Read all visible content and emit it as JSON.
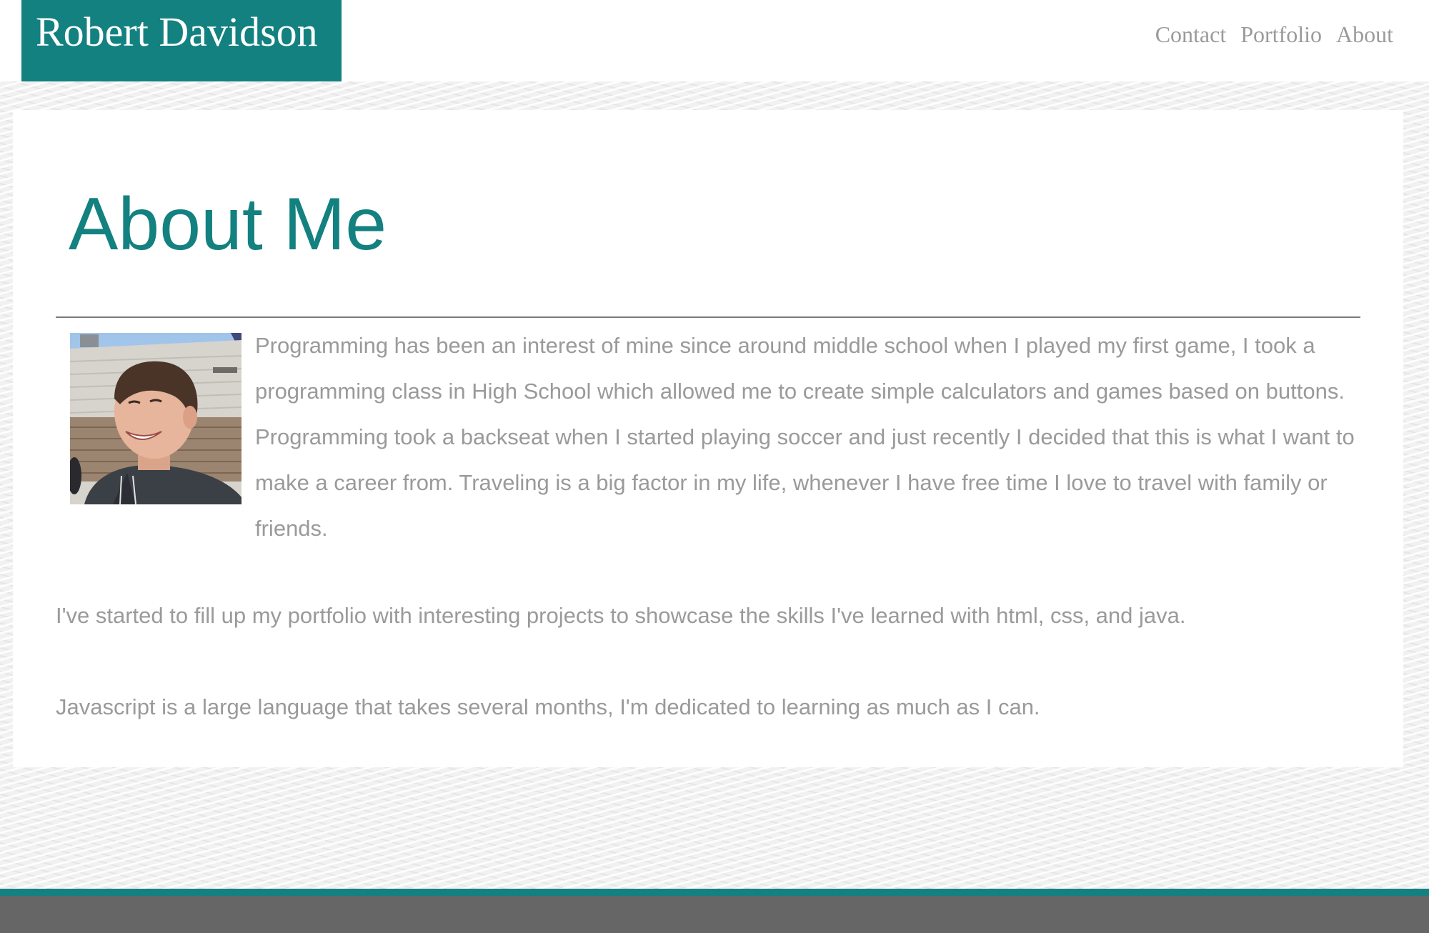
{
  "header": {
    "brand": "Robert Davidson",
    "nav": [
      {
        "label": "Contact"
      },
      {
        "label": "Portfolio"
      },
      {
        "label": "About"
      }
    ]
  },
  "main": {
    "title": "About Me",
    "paragraphs": [
      "Programming has been an interest of mine since around middle school when I played my first game, I took a programming class in High School which allowed me to create simple calculators and games based on buttons. Programming took a backseat when I started playing soccer and just recently I decided that this is what I want to make a career from. Traveling is a big factor in my life, whenever I have free time I love to travel with family or friends.",
      "I've started to fill up my portfolio with interesting projects to showcase the skills I've learned with html, css, and java.",
      "Javascript is a large language that takes several months, I'm dedicated to learning as much as I can."
    ]
  },
  "colors": {
    "accent": "#138180",
    "text_muted": "#9a9a9a",
    "footer": "#666666"
  }
}
